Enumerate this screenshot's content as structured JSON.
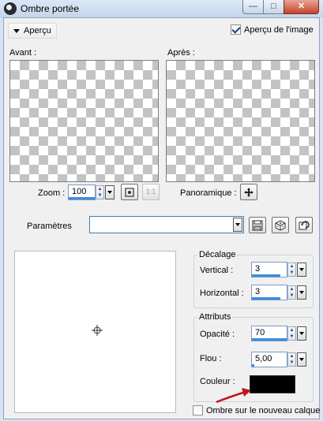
{
  "window": {
    "title": "Ombre portée",
    "min_glyph": "—",
    "max_glyph": "□",
    "close_glyph": "✕"
  },
  "preview_toggle": {
    "label": "Aperçu"
  },
  "image_preview": {
    "label": "Aperçu de l'image",
    "checked": true
  },
  "before": {
    "label": "Avant :"
  },
  "after": {
    "label": "Après :"
  },
  "zoom": {
    "label": "Zoom :",
    "value": "100",
    "one_to_one": "1:1"
  },
  "pan": {
    "label": "Panoramique :"
  },
  "params": {
    "label": "Paramètres",
    "value": ""
  },
  "offset": {
    "title": "Décalage",
    "vertical_label": "Vertical :",
    "vertical_value": "3",
    "horizontal_label": "Horizontal :",
    "horizontal_value": "3"
  },
  "attributes": {
    "title": "Attributs",
    "opacity_label": "Opacité :",
    "opacity_value": "70",
    "blur_label": "Flou :",
    "blur_value": "5,00",
    "color_label": "Couleur :",
    "color_value": "#000000"
  },
  "new_layer": {
    "label": "Ombre sur le nouveau calque",
    "checked": false
  },
  "colors": {
    "accent": "#3c8be0",
    "arrow": "#c0141b"
  }
}
